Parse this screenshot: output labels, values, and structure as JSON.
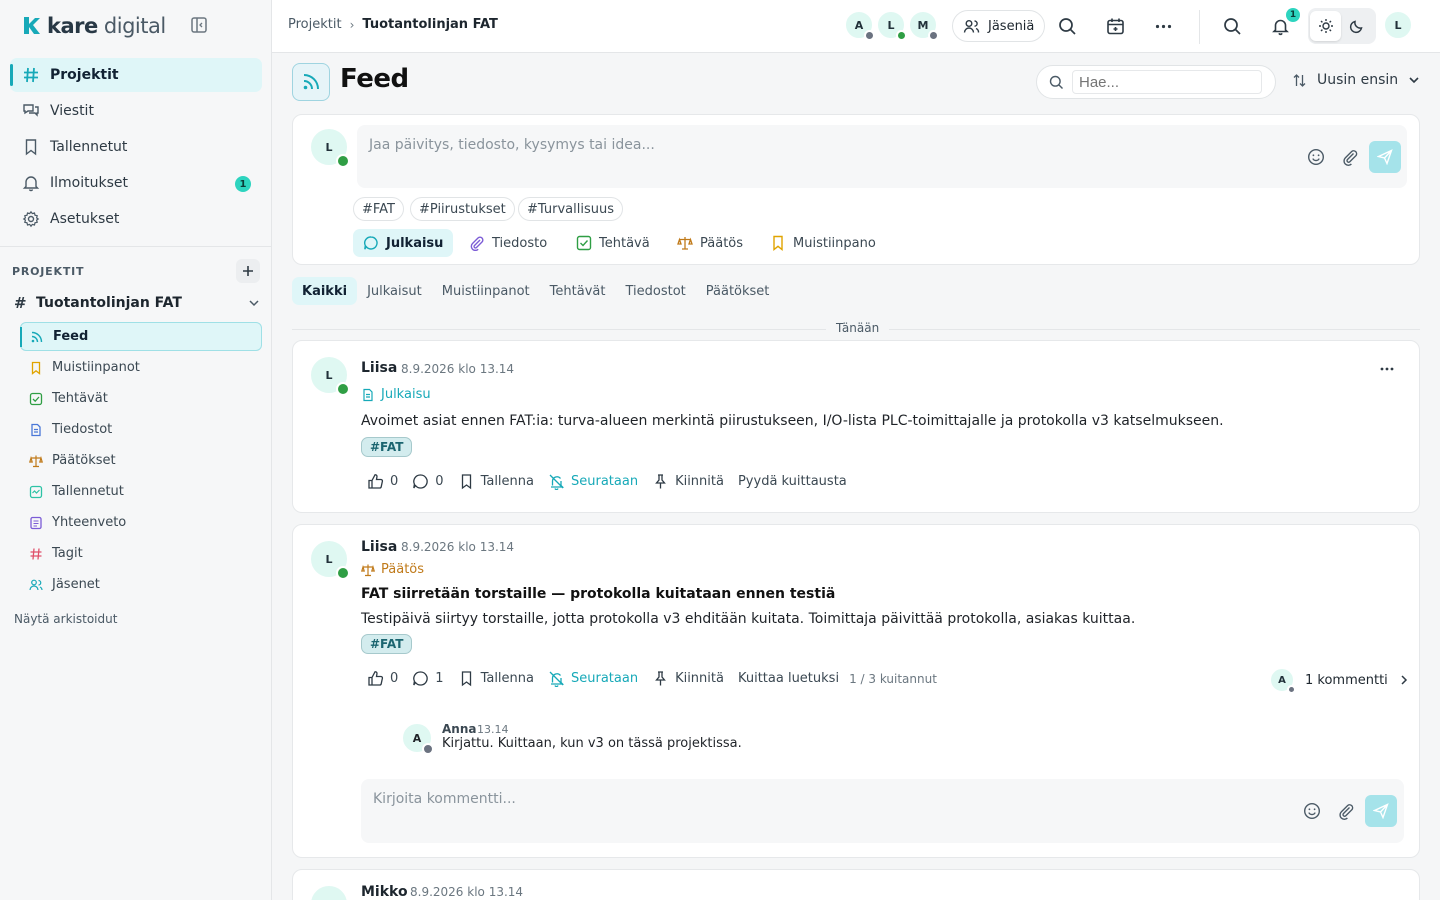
{
  "brand": {
    "bold": "kare",
    "light": " digital"
  },
  "nav": [
    {
      "label": "Projektit",
      "icon": "hash-icon",
      "active": true
    },
    {
      "label": "Viestit",
      "icon": "messages-icon"
    },
    {
      "label": "Tallennetut",
      "icon": "bookmark-icon"
    },
    {
      "label": "Ilmoitukset",
      "icon": "bell-icon",
      "badge": "1"
    },
    {
      "label": "Asetukset",
      "icon": "gear-icon"
    }
  ],
  "projects_header": "PROJEKTIT",
  "project": {
    "name": "Tuotantolinjan FAT",
    "items": [
      {
        "label": "Feed",
        "icon": "feed-icon",
        "color": "#17a9b8",
        "active": true
      },
      {
        "label": "Muistiinpanot",
        "icon": "bookmark-icon",
        "color": "#e0a400"
      },
      {
        "label": "Tehtävät",
        "icon": "check-icon",
        "color": "#2f9e44"
      },
      {
        "label": "Tiedostot",
        "icon": "file-icon",
        "color": "#4a78d8"
      },
      {
        "label": "Päätökset",
        "icon": "scale-icon",
        "color": "#c07a1a"
      },
      {
        "label": "Tallennetut",
        "icon": "saved-icon",
        "color": "#2dc3a5"
      },
      {
        "label": "Yhteenveto",
        "icon": "summary-icon",
        "color": "#7c5cd6"
      },
      {
        "label": "Tagit",
        "icon": "tag-icon",
        "color": "#e0506a"
      },
      {
        "label": "Jäsenet",
        "icon": "users-icon",
        "color": "#17a9b8"
      }
    ]
  },
  "show_archived": "Näytä arkistoidut",
  "breadcrumb": {
    "root": "Projektit",
    "current": "Tuotantolinjan FAT"
  },
  "top_avatars": [
    {
      "initial": "A",
      "status": "grey"
    },
    {
      "initial": "L",
      "status": "green"
    },
    {
      "initial": "M",
      "status": "grey"
    }
  ],
  "members_label": "Jäseniä",
  "notifications_count": "1",
  "me_initial": "L",
  "page_title": "Feed",
  "search_placeholder": "Hae...",
  "sort_label": "Uusin ensin",
  "composer": {
    "avatar": "L",
    "placeholder": "Jaa päivitys, tiedosto, kysymys tai idea...",
    "tags": [
      "#FAT",
      "#Piirustukset",
      "#Turvallisuus"
    ],
    "types": [
      "Julkaisu",
      "Tiedosto",
      "Tehtävä",
      "Päätös",
      "Muistiinpano"
    ]
  },
  "filters": [
    "Kaikki",
    "Julkaisut",
    "Muistiinpanot",
    "Tehtävät",
    "Tiedostot",
    "Päätökset"
  ],
  "day_label": "Tänään",
  "posts": [
    {
      "avatar": "L",
      "author": "Liisa",
      "time": "8.9.2026 klo 13.14",
      "type": "Julkaisu",
      "text": "Avoimet asiat ennen FAT:ia: turva-alueen merkintä piirustukseen, I/O-lista PLC-toimittajalle ja protokolla v3 katselmukseen.",
      "tag": "#FAT",
      "likes": "0",
      "comments": "0",
      "save": "Tallenna",
      "follow": "Seurataan",
      "pin": "Kiinnitä",
      "ack": "Pyydä kuittausta"
    },
    {
      "avatar": "L",
      "author": "Liisa",
      "time": "8.9.2026 klo 13.14",
      "type": "Päätös",
      "title": "FAT siirretään torstaille — protokolla kuitataan ennen testiä",
      "text": "Testipäivä siirtyy torstaille, jotta protokolla v3 ehditään kuitata. Toimittaja päivittää protokolla, asiakas kuittaa.",
      "tag": "#FAT",
      "likes": "0",
      "comments": "1",
      "save": "Tallenna",
      "follow": "Seurataan",
      "pin": "Kiinnitä",
      "ack": "Kuittaa luetuksi",
      "ack_count": "1 / 3 kuitannut",
      "comment_link": "1 kommentti",
      "comment_link_avatar": "A",
      "comment": {
        "avatar": "A",
        "author": "Anna",
        "time": "13.14",
        "text": "Kirjattu. Kuittaan, kun v3 on tässä projektissa."
      },
      "comment_placeholder": "Kirjoita kommentti..."
    },
    {
      "avatar": "M",
      "author": "Mikko",
      "time": "8.9.2026 klo 13.14"
    }
  ],
  "colors": {
    "accent": "#17a9b8",
    "online": "#2f9e44",
    "away": "#6b7280",
    "decision": "#c07a1a",
    "post": "#17a9b8"
  }
}
